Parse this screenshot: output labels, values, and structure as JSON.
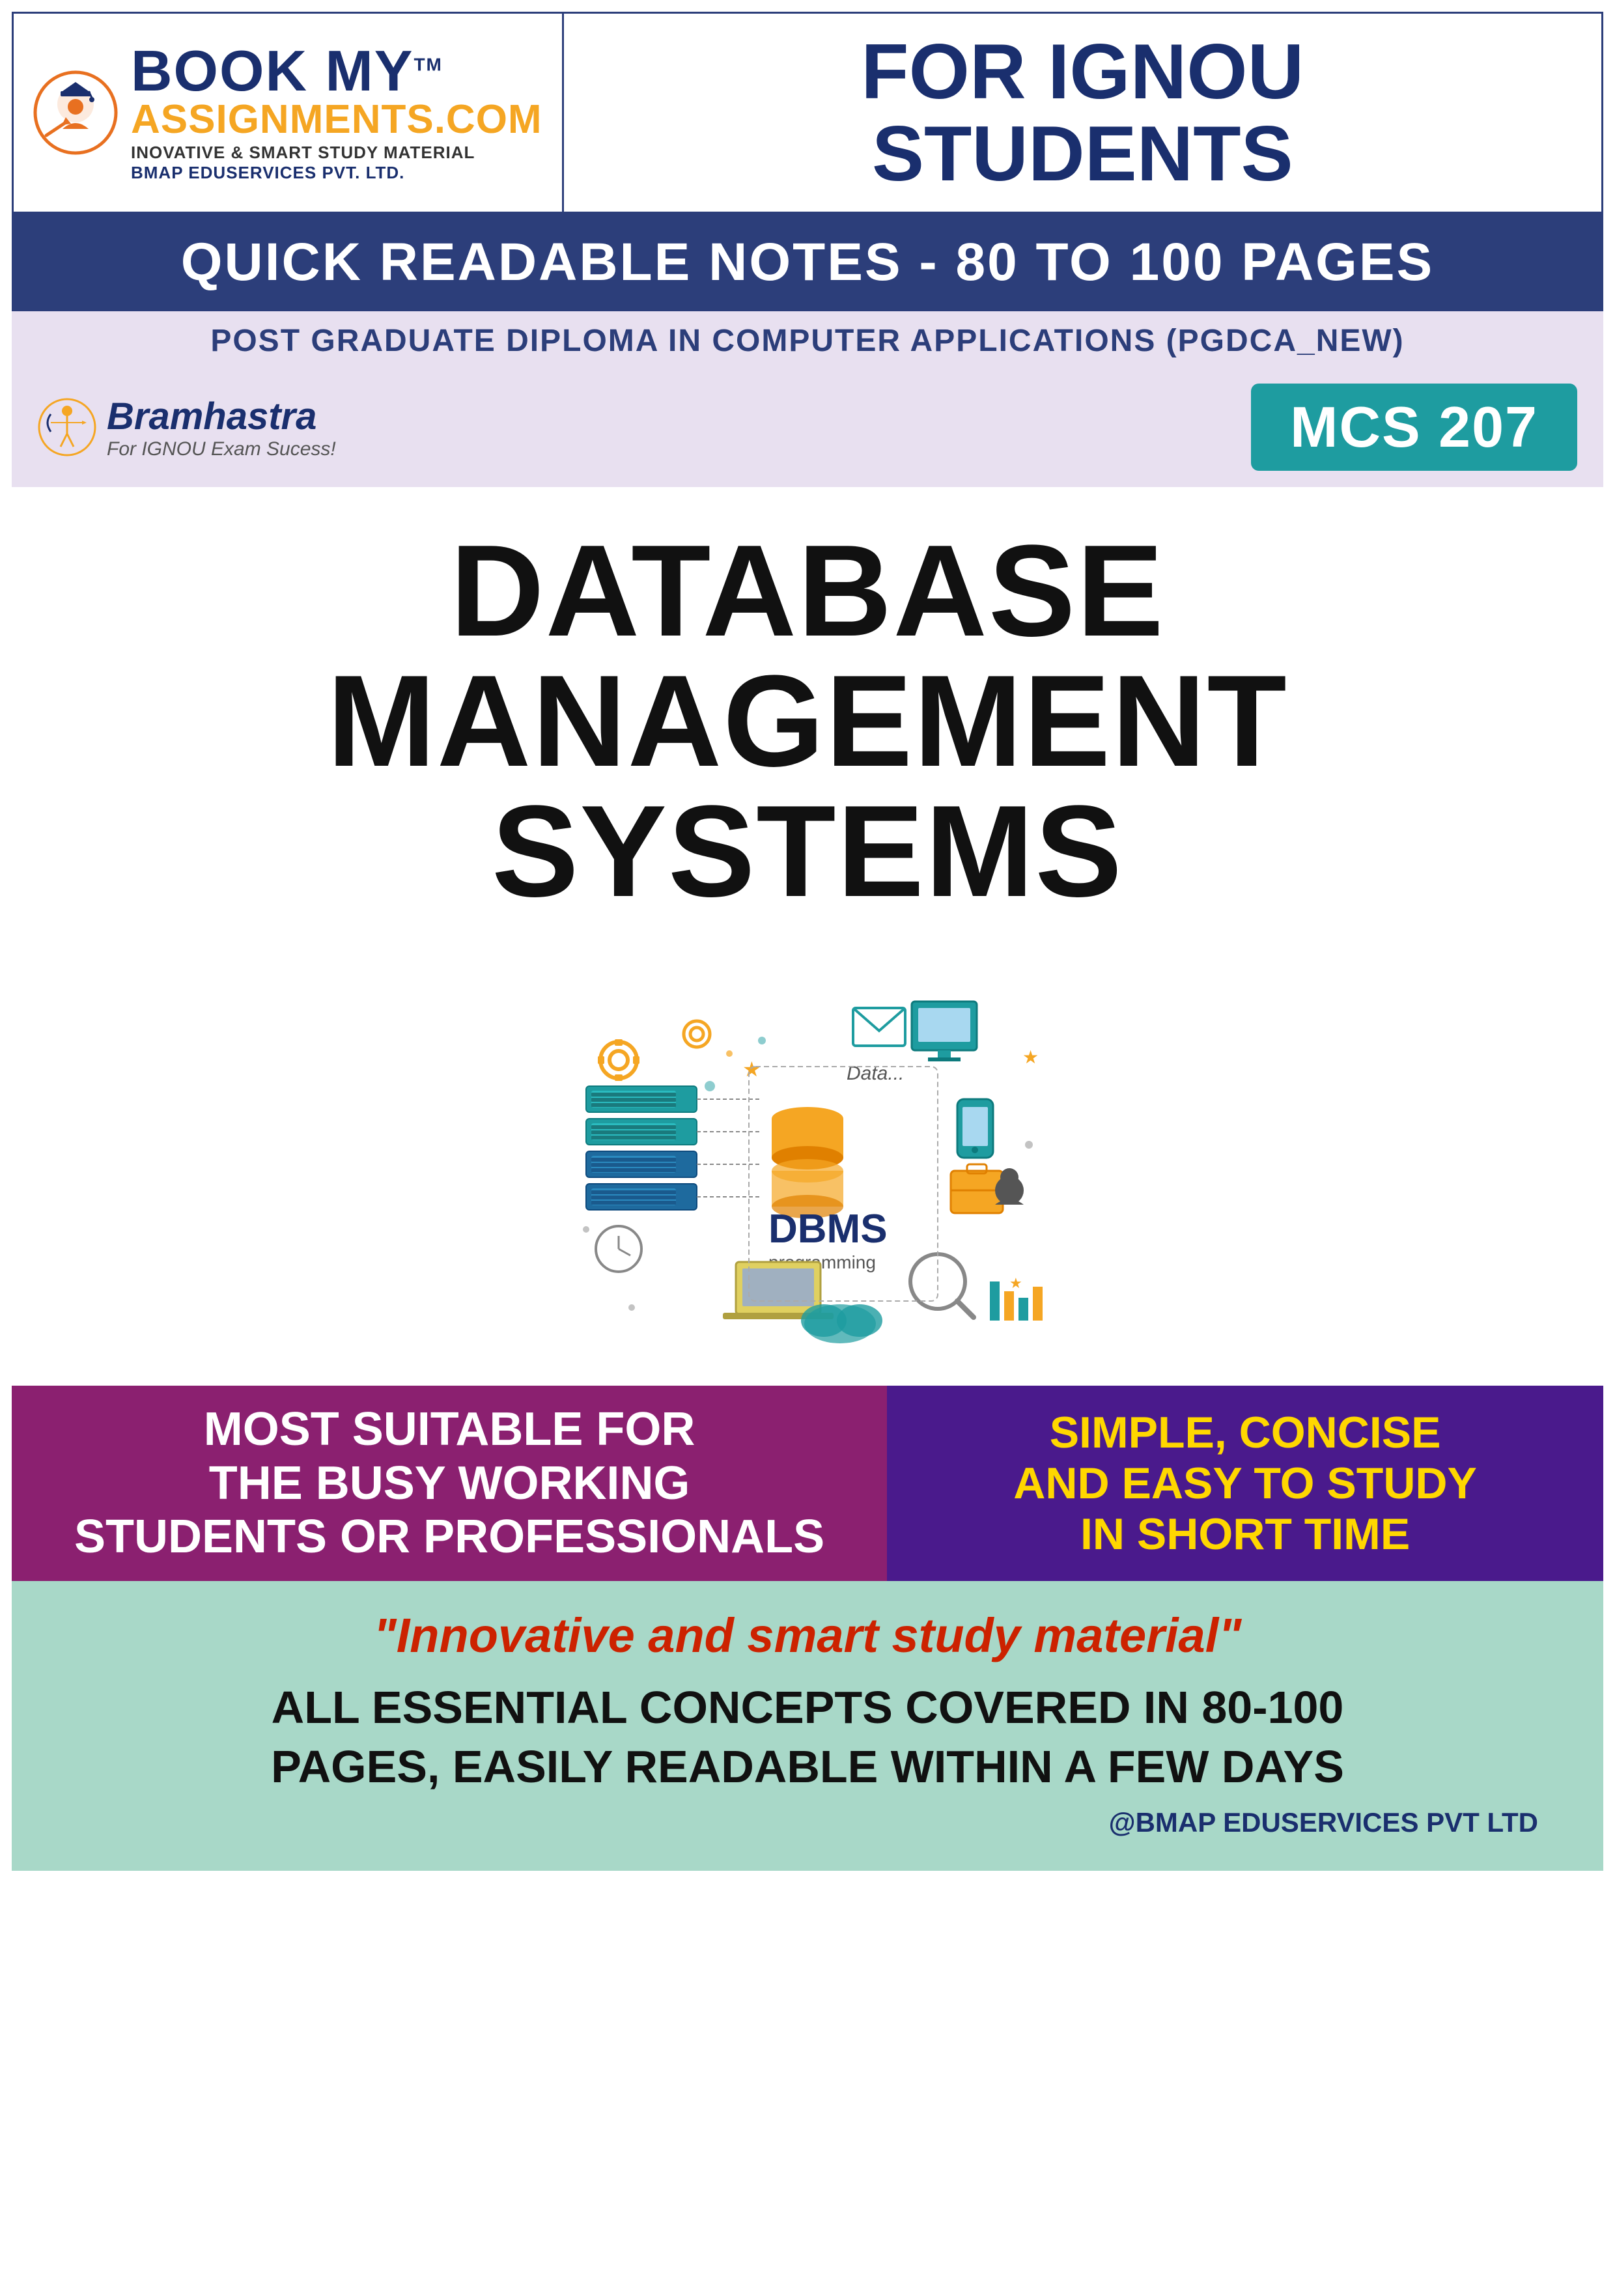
{
  "header": {
    "book_my": "BOOK MY",
    "tm": "TM",
    "assignments": "ASSIGNMENTS.COM",
    "tagline": "INOVATIVE & SMART STUDY MATERIAL",
    "company": "BMAP EDUSERVICES PVT. LTD.",
    "for_ignou": "FOR IGNOU\nSTUDENTS"
  },
  "quick_notes": {
    "text": "QUICK READABLE NOTES - 80 TO 100 PAGES"
  },
  "pgdca": {
    "text": "POST GRADUATE DIPLOMA IN COMPUTER APPLICATIONS (PGDCA_NEW)"
  },
  "course": {
    "bramhastra_name": "Bramhastra",
    "bramhastra_sub": "For IGNOU Exam Sucess!",
    "mcs_code": "MCS 207"
  },
  "title": {
    "line1": "DATABASE MANAGEMENT",
    "line2": "SYSTEMS"
  },
  "illustration": {
    "label": "DBMS Illustration"
  },
  "bottom_left": {
    "line1": "MOST SUITABLE FOR",
    "line2": "THE BUSY WORKING",
    "line3": "STUDENTS OR PROFESSIONALS"
  },
  "bottom_right": {
    "line1": "SIMPLE, CONCISE",
    "line2": "AND EASY TO STUDY",
    "line3": "IN SHORT TIME"
  },
  "innovative": {
    "quote": "\"Innovative and smart study material\"",
    "concepts": "ALL ESSENTIAL CONCEPTS COVERED IN 80-100\nPAGES, EASILY READABLE WITHIN A FEW DAYS"
  },
  "footer": {
    "brand": "@BMAP EDUSERVICES PVT LTD"
  }
}
